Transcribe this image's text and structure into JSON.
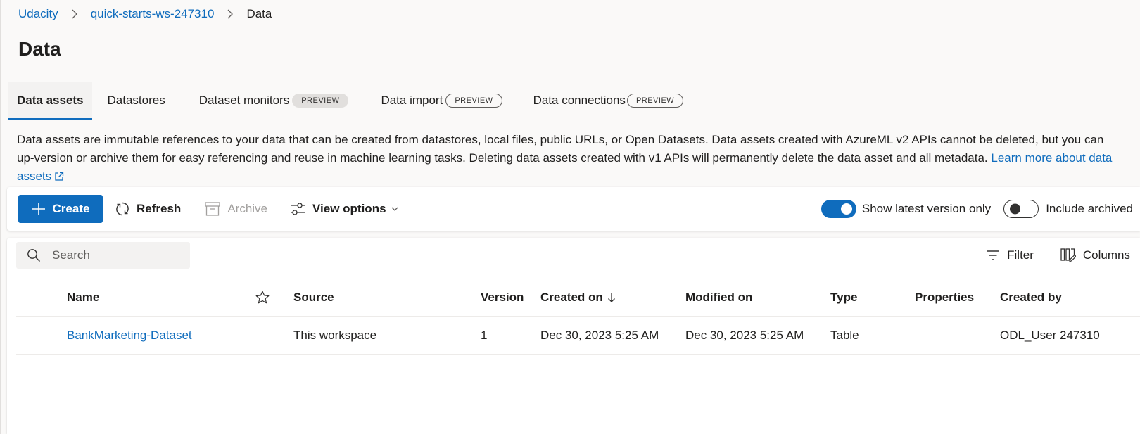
{
  "breadcrumb": {
    "items": [
      "Udacity",
      "quick-starts-ws-247310"
    ],
    "current": "Data"
  },
  "page": {
    "title": "Data"
  },
  "tabs": [
    {
      "label": "Data assets",
      "active": true,
      "badge": ""
    },
    {
      "label": "Datastores",
      "active": false,
      "badge": ""
    },
    {
      "label": "Dataset monitors",
      "active": false,
      "badge": "PREVIEW"
    },
    {
      "label": "Data import",
      "active": false,
      "badge": "PREVIEW"
    },
    {
      "label": "Data connections",
      "active": false,
      "badge": "PREVIEW"
    }
  ],
  "description": {
    "text": "Data assets are immutable references to your data that can be created from datastores, local files, public URLs, or Open Datasets. Data assets created with AzureML v2 APIs cannot be deleted, but you can up-version or archive them for easy referencing and reuse in machine learning tasks. Deleting data assets created with v1 APIs will permanently delete the data asset and all metadata.",
    "link_text": "Learn more about data assets"
  },
  "toolbar": {
    "create_label": "Create",
    "refresh_label": "Refresh",
    "archive_label": "Archive",
    "view_options_label": "View options",
    "latest_version_label": "Show latest version only",
    "latest_version_on": true,
    "include_archived_label": "Include archived",
    "include_archived_on": false
  },
  "list": {
    "search_placeholder": "Search",
    "filter_label": "Filter",
    "columns_label": "Columns",
    "headers": {
      "name": "Name",
      "source": "Source",
      "version": "Version",
      "created_on": "Created on",
      "modified_on": "Modified on",
      "type": "Type",
      "properties": "Properties",
      "created_by": "Created by"
    },
    "sort": {
      "column": "created_on",
      "direction": "descending"
    },
    "rows": [
      {
        "name": "BankMarketing-Dataset",
        "source": "This workspace",
        "version": "1",
        "created_on": "Dec 30, 2023 5:25 AM",
        "modified_on": "Dec 30, 2023 5:25 AM",
        "type": "Table",
        "properties": "",
        "created_by": "ODL_User 247310"
      }
    ]
  },
  "colors": {
    "accent": "#0f6cbd",
    "text": "#201f1e",
    "disabled": "#a19f9d",
    "background": "#faf9f8"
  },
  "icons": {
    "crumb_separator": "chevron-right-icon",
    "create": "plus-icon",
    "refresh": "refresh-icon",
    "archive": "archive-icon",
    "view_options": "sliders-icon",
    "dropdown": "chevron-down-icon",
    "search": "search-icon",
    "filter": "filter-icon",
    "columns": "columns-icon",
    "favorite": "star-icon",
    "sort": "arrow-down-icon",
    "external_link": "external-link-icon"
  }
}
